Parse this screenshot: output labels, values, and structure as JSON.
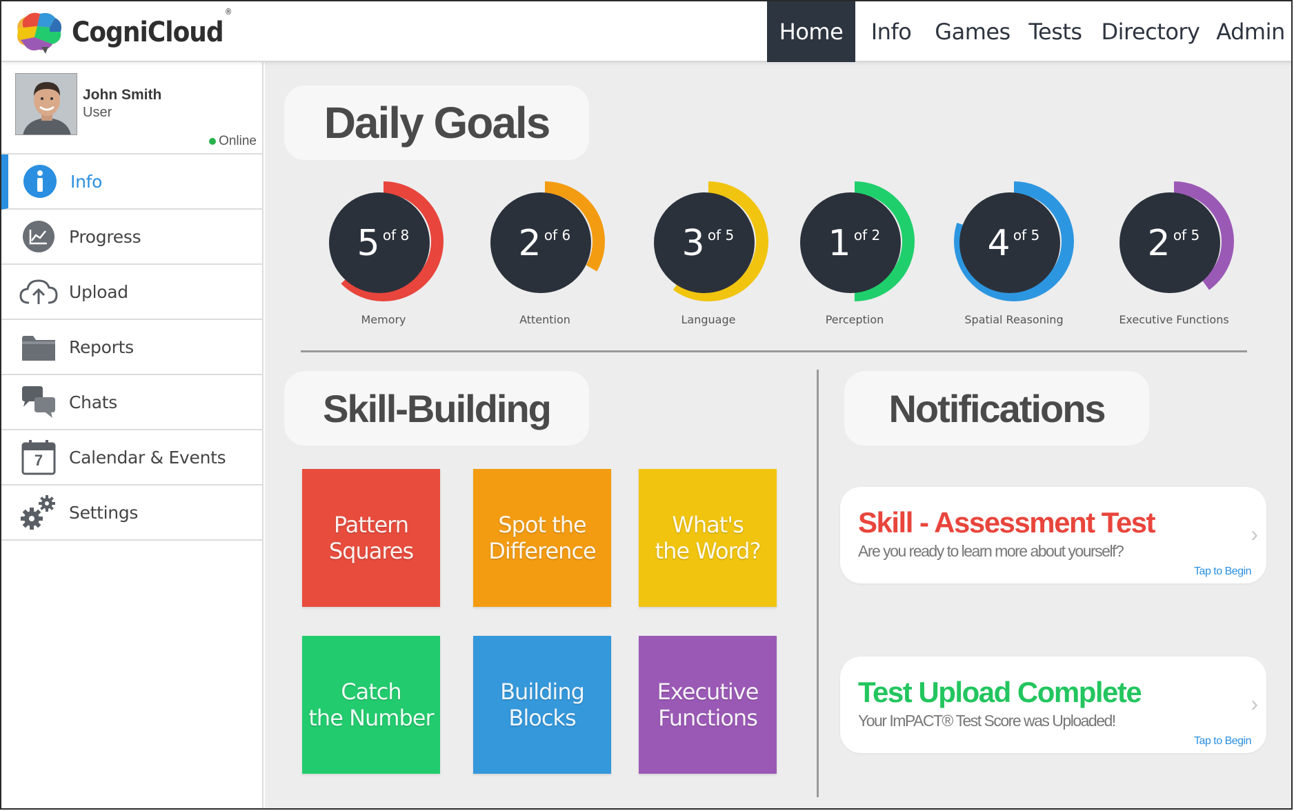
{
  "app": {
    "name": "CogniCloud",
    "registered_mark": "®"
  },
  "nav": {
    "items": [
      {
        "label": "Home",
        "active": true
      },
      {
        "label": "Info",
        "active": false
      },
      {
        "label": "Games",
        "active": false
      },
      {
        "label": "Tests",
        "active": false
      },
      {
        "label": "Directory",
        "active": false
      },
      {
        "label": "Admin",
        "active": false
      }
    ]
  },
  "user": {
    "name": "John Smith",
    "role": "User",
    "status": "Online",
    "status_color": "#28b24b"
  },
  "sidebar": {
    "items": [
      {
        "label": "Info",
        "icon": "info-icon",
        "active": true
      },
      {
        "label": "Progress",
        "icon": "chart-icon",
        "active": false
      },
      {
        "label": "Upload",
        "icon": "cloud-upload-icon",
        "active": false
      },
      {
        "label": "Reports",
        "icon": "folder-icon",
        "active": false
      },
      {
        "label": "Chats",
        "icon": "chat-bubbles-icon",
        "active": false
      },
      {
        "label": "Calendar & Events",
        "icon": "calendar-icon",
        "active": false,
        "icon_text": "7"
      },
      {
        "label": "Settings",
        "icon": "gears-icon",
        "active": false
      }
    ]
  },
  "daily_goals": {
    "title": "Daily Goals",
    "goals": [
      {
        "value": "5",
        "of": "of 8",
        "done": 5,
        "total": 8,
        "label": "Memory",
        "color": "#e8453c"
      },
      {
        "value": "2",
        "of": "of 6",
        "done": 2,
        "total": 6,
        "label": "Attention",
        "color": "#f39c12"
      },
      {
        "value": "3",
        "of": "of 5",
        "done": 3,
        "total": 5,
        "label": "Language",
        "color": "#f1c40f"
      },
      {
        "value": "1",
        "of": "of 2",
        "done": 1,
        "total": 2,
        "label": "Perception",
        "color": "#1fcf6c"
      },
      {
        "value": "4",
        "of": "of 5",
        "done": 4,
        "total": 5,
        "label": "Spatial Reasoning",
        "color": "#2d96e0"
      },
      {
        "value": "2",
        "of": "of 5",
        "done": 2,
        "total": 5,
        "label": "Executive Functions",
        "color": "#9b59b6"
      }
    ]
  },
  "skill_building": {
    "title": "Skill-Building",
    "tiles": [
      {
        "label": "Pattern\nSquares",
        "color": "#e84c3d"
      },
      {
        "label": "Spot the\nDifference",
        "color": "#f39c12"
      },
      {
        "label": "What's\nthe Word?",
        "color": "#f1c40f"
      },
      {
        "label": "Catch\nthe Number",
        "color": "#22cc6e"
      },
      {
        "label": "Building\nBlocks",
        "color": "#3498db"
      },
      {
        "label": "Executive\nFunctions",
        "color": "#9b59b6"
      }
    ]
  },
  "notifications": {
    "title": "Notifications",
    "items": [
      {
        "title": "Skill - Assessment Test",
        "subtitle": "Are you ready to learn more about yourself?",
        "cta": "Tap to Begin",
        "color": "#e8453c"
      },
      {
        "title": "Test Upload Complete",
        "subtitle": "Your ImPACT® Test Score was Uploaded!",
        "cta": "Tap to Begin",
        "color": "#22c55e"
      }
    ]
  }
}
